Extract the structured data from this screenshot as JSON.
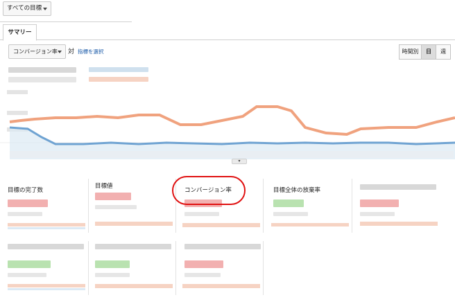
{
  "goal_selector": {
    "label": "すべての目標",
    "icon": "chevron-down-icon"
  },
  "tabs": [
    {
      "label": "サマリー",
      "active": true
    }
  ],
  "metric_selector": {
    "label": "コンバージョン率",
    "icon": "chevron-down-icon"
  },
  "compare": {
    "vs_label": "対",
    "select_metric_link": "指標を選択"
  },
  "period_buttons": [
    {
      "label": "時間別",
      "active": false
    },
    {
      "label": "日",
      "active": true
    },
    {
      "label": "週",
      "active": false
    }
  ],
  "colors": {
    "primary_series": "#f0a27e",
    "secondary_series": "#6fa3d2",
    "highlight": "#e01010",
    "link": "#1a5aa8"
  },
  "cards": [
    {
      "title": "目標の完了数",
      "value_color": "red"
    },
    {
      "title": "目標値",
      "value_color": "red"
    },
    {
      "title": "コンバージョン率",
      "value_color": "red",
      "highlighted": true
    },
    {
      "title": "目標全体の放棄率",
      "value_color": "green"
    },
    {
      "title": "",
      "value_color": "red"
    },
    {
      "title": "",
      "value_color": "green"
    },
    {
      "title": "",
      "value_color": "green"
    },
    {
      "title": "",
      "value_color": "red"
    }
  ]
}
